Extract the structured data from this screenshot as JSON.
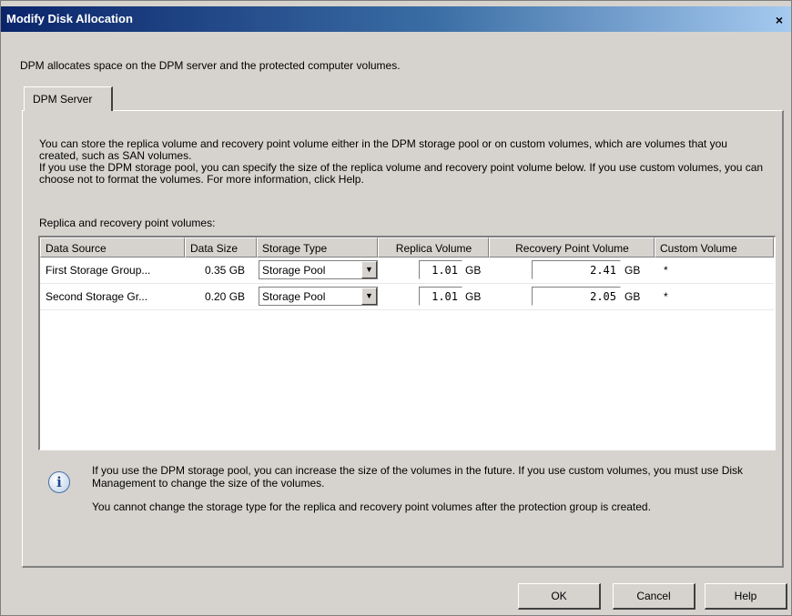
{
  "window": {
    "title": "Modify Disk Allocation",
    "close_glyph": "×"
  },
  "intro": "DPM allocates space on the DPM server and the protected computer volumes.",
  "tab_label": "DPM Server",
  "description": {
    "line1": "You can store the replica volume and recovery point volume either in the DPM storage pool or on custom volumes, which are volumes that you created, such as SAN volumes.",
    "line2": "If you use the DPM storage pool, you can specify the size of the replica volume and recovery point volume below. If you use custom volumes, you can choose not to format the volumes. For more information, click Help."
  },
  "replica_label": "Replica and recovery point volumes:",
  "columns": [
    "Data Source",
    "Data Size",
    "Storage Type",
    "Replica Volume",
    "Recovery Point Volume",
    "Custom Volume"
  ],
  "rows": [
    {
      "source": "First Storage Group...",
      "size": "0.35 GB",
      "storage_type": "Storage Pool",
      "replica": "1.01",
      "replica_unit": "GB",
      "recovery": "2.41",
      "recovery_unit": "GB",
      "custom": "*"
    },
    {
      "source": "Second Storage Gr...",
      "size": "0.20 GB",
      "storage_type": "Storage Pool",
      "replica": "1.01",
      "replica_unit": "GB",
      "recovery": "2.05",
      "recovery_unit": "GB",
      "custom": "*"
    }
  ],
  "info": {
    "icon": "info-icon",
    "text1": "If you use the DPM storage pool, you can increase the size of the volumes in the future. If you use custom volumes, you must use Disk Management to change the size of the volumes.",
    "text2": "You cannot change the storage type for the replica and recovery point volumes after the protection group is created."
  },
  "buttons": {
    "ok": "OK",
    "cancel": "Cancel",
    "help": "Help"
  }
}
